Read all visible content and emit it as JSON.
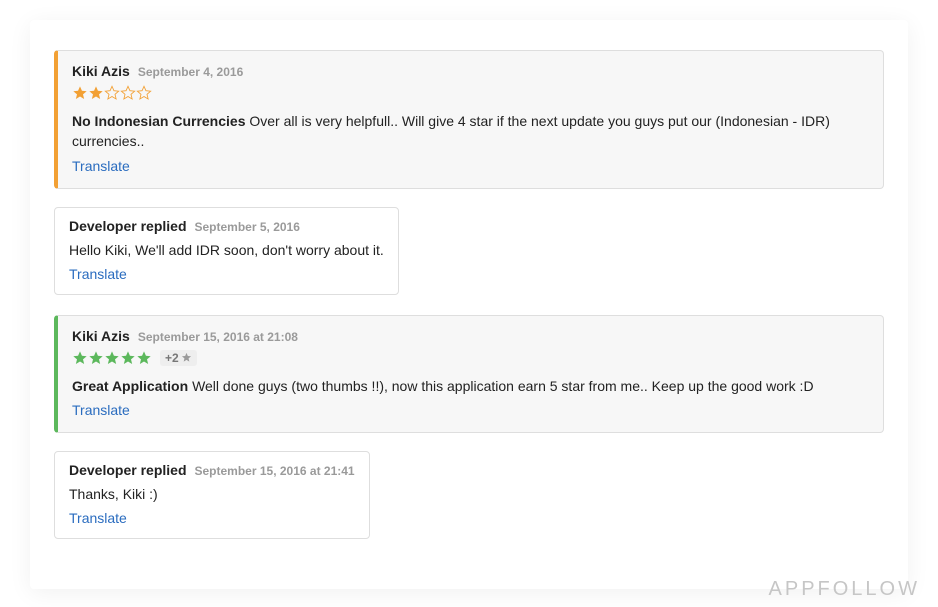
{
  "watermark": "APPFOLLOW",
  "translate_label": "Translate",
  "reviews": [
    {
      "author": "Kiki Azis",
      "date": "September 4, 2016",
      "accent": "orange",
      "rating": 2,
      "rating_max": 5,
      "rating_delta": null,
      "title": "No Indonesian Currencies",
      "body": "Over all is very helpfull.. Will give 4 star if the next update you guys put our (Indonesian - IDR) currencies..",
      "reply": {
        "author": "Developer replied",
        "date": "September 5, 2016",
        "body": "Hello Kiki, We'll add IDR soon, don't worry about it."
      }
    },
    {
      "author": "Kiki Azis",
      "date": "September 15, 2016 at 21:08",
      "accent": "green",
      "rating": 5,
      "rating_max": 5,
      "rating_delta": "+2",
      "title": "Great Application",
      "body": "Well done guys (two thumbs !!), now this application earn 5 star from me.. Keep up the good work :D",
      "reply": {
        "author": "Developer replied",
        "date": "September 15, 2016 at 21:41",
        "body": "Thanks, Kiki :)"
      }
    }
  ]
}
